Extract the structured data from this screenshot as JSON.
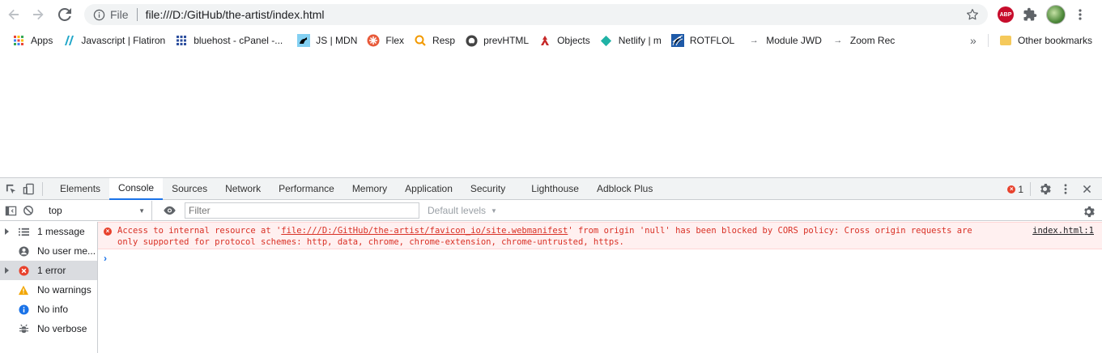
{
  "browser": {
    "scheme_label": "File",
    "url": "file:///D:/GitHub/the-artist/index.html",
    "abp_label": "ABP"
  },
  "bookmarks": {
    "items": [
      {
        "label": "Apps",
        "icon": "apps-grid-icon"
      },
      {
        "label": "Javascript | Flatiron",
        "icon": "flatiron-icon"
      },
      {
        "label": "bluehost - cPanel -...",
        "icon": "bluehost-icon"
      },
      {
        "label": "JS | MDN",
        "icon": "mdn-icon"
      },
      {
        "label": "Flex",
        "icon": "flex-icon"
      },
      {
        "label": "Resp",
        "icon": "resp-icon"
      },
      {
        "label": "prevHTML",
        "icon": "github-icon"
      },
      {
        "label": "Objects",
        "icon": "objects-icon"
      },
      {
        "label": "Netlify | m",
        "icon": "netlify-icon"
      },
      {
        "label": "ROTFLOL",
        "icon": "rotflol-icon"
      },
      {
        "label": "Module JWD",
        "icon": "arrow-icon"
      },
      {
        "label": "Zoom Rec",
        "icon": "arrow-icon"
      }
    ],
    "overflow": "»",
    "other_label": "Other bookmarks"
  },
  "devtools": {
    "tabs": [
      "Elements",
      "Console",
      "Sources",
      "Network",
      "Performance",
      "Memory",
      "Application",
      "Security",
      "Lighthouse",
      "Adblock Plus"
    ],
    "active_tab": "Console",
    "error_count": "1",
    "context": "top",
    "filter_placeholder": "Filter",
    "levels_label": "Default levels",
    "sidebar": [
      {
        "label": "1 message",
        "icon": "list-icon",
        "expandable": true
      },
      {
        "label": "No user me...",
        "icon": "user-icon",
        "expandable": false
      },
      {
        "label": "1 error",
        "icon": "error-icon",
        "expandable": true
      },
      {
        "label": "No warnings",
        "icon": "warning-icon",
        "expandable": false
      },
      {
        "label": "No info",
        "icon": "info-icon",
        "expandable": false
      },
      {
        "label": "No verbose",
        "icon": "bug-icon",
        "expandable": false
      }
    ],
    "error_message": {
      "prefix": "Access to internal resource at '",
      "link": "file:///D:/GitHub/the-artist/favicon_io/site.webmanifest",
      "suffix": "' from origin 'null' has been blocked by CORS policy: Cross origin requests are",
      "line2": "only supported for protocol schemes: http, data, chrome, chrome-extension, chrome-untrusted, https.",
      "source": "index.html:1"
    },
    "prompt": "›"
  },
  "colors": {
    "error": "#d93025",
    "accent": "#1a73e8"
  }
}
